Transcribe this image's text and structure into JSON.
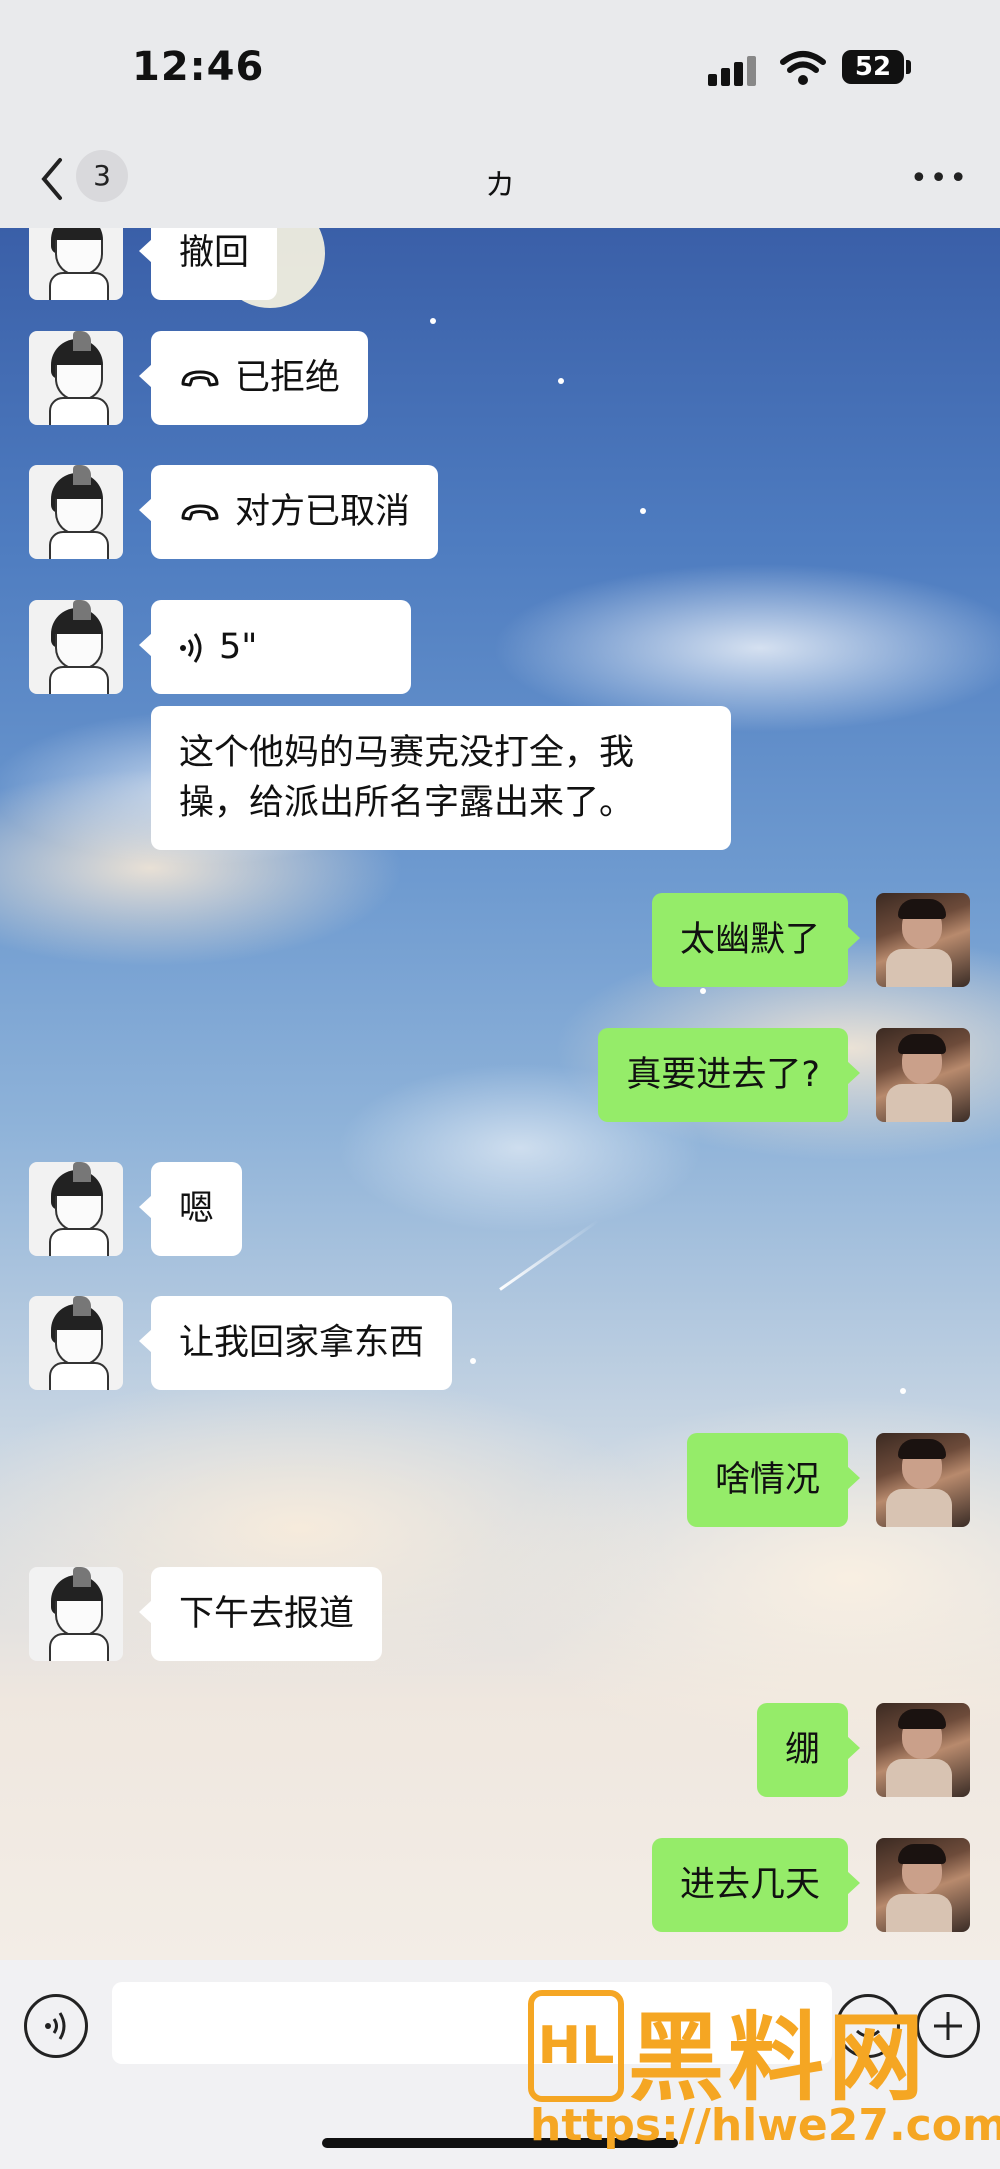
{
  "status_bar": {
    "time": "12:46",
    "battery": "52"
  },
  "header": {
    "back_count": "3",
    "title": "カ",
    "more": "•••"
  },
  "messages": [
    {
      "side": "left",
      "text": "撤回"
    },
    {
      "side": "left",
      "type": "call",
      "text": "已拒绝"
    },
    {
      "side": "left",
      "type": "call",
      "text": "对方已取消"
    },
    {
      "side": "left",
      "type": "voice",
      "text": "5\""
    },
    {
      "side": "left",
      "text": "这个他妈的马赛克没打全，我操，给派出所名字露出来了。"
    },
    {
      "side": "right",
      "text": "太幽默了"
    },
    {
      "side": "right",
      "text": "真要进去了?"
    },
    {
      "side": "left",
      "text": "嗯"
    },
    {
      "side": "left",
      "text": "让我回家拿东西"
    },
    {
      "side": "right",
      "text": "啥情况"
    },
    {
      "side": "left",
      "text": "下午去报道"
    },
    {
      "side": "right",
      "text": "绷"
    },
    {
      "side": "right",
      "text": "进去几天"
    }
  ],
  "watermark": {
    "logo": "HL",
    "name": "黑料网",
    "url": "https://hlwe27.com"
  }
}
